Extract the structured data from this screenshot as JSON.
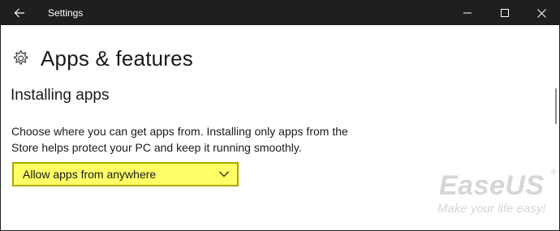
{
  "window": {
    "title": "Settings",
    "controls": {
      "minimize": "minimize-icon",
      "maximize": "maximize-icon",
      "close": "close-icon"
    },
    "back_icon": "back-arrow-icon"
  },
  "page": {
    "title": "Apps & features",
    "icon": "gear-icon"
  },
  "section": {
    "title": "Installing apps",
    "description_line1": "Choose where you can get apps from. Installing only apps from the",
    "description_line2": "Store helps protect your PC and keep it running smoothly."
  },
  "dropdown": {
    "selected": "Allow apps from anywhere",
    "highlight_color": "#ffff66"
  },
  "watermark": {
    "brand": "EaseUS",
    "registered": "®",
    "tagline": "Make your life easy!"
  },
  "colors": {
    "titlebar": "#1f1f1f",
    "text": "#1a1a1a"
  }
}
